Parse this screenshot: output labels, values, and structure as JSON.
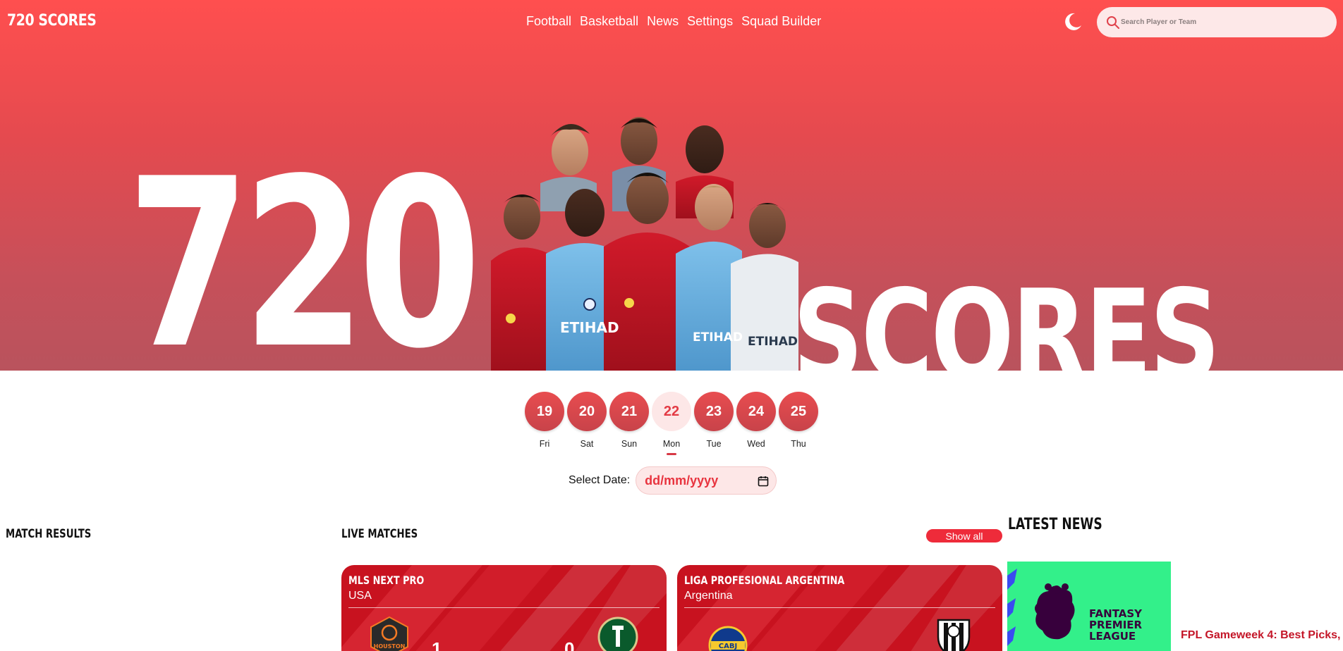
{
  "brand": "720 SCORES",
  "nav": {
    "links": [
      "Football",
      "Basketball",
      "News",
      "Settings",
      "Squad Builder"
    ]
  },
  "search": {
    "placeholder": "Search Player or Team"
  },
  "hero": {
    "big_number": "720",
    "big_word": "SCORES"
  },
  "days": [
    {
      "date": "19",
      "weekday": "Fri",
      "active": false
    },
    {
      "date": "20",
      "weekday": "Sat",
      "active": false
    },
    {
      "date": "21",
      "weekday": "Sun",
      "active": false
    },
    {
      "date": "22",
      "weekday": "Mon",
      "active": true
    },
    {
      "date": "23",
      "weekday": "Tue",
      "active": false
    },
    {
      "date": "24",
      "weekday": "Wed",
      "active": false
    },
    {
      "date": "25",
      "weekday": "Thu",
      "active": false
    }
  ],
  "date_picker": {
    "label": "Select Date:",
    "placeholder": "dd/mm/yyyy"
  },
  "sections": {
    "match_results": "MATCH RESULTS",
    "live_matches": "LIVE MATCHES",
    "latest_news": "LATEST NEWS",
    "show_all": "Show all"
  },
  "live_matches": [
    {
      "league": "MLS NEXT PRO",
      "country": "USA",
      "home_score": "1",
      "away_score": "0",
      "home_logo_text": "HOUSTON"
    },
    {
      "league": "LIGA PROFESIONAL ARGENTINA",
      "country": "Argentina",
      "home_logo_text": "CABJ"
    }
  ],
  "news": {
    "image_text": [
      "FANTASY",
      "PREMIER",
      "LEAGUE"
    ],
    "headline": "FPL Gameweek 4: Best Picks,"
  },
  "colors": {
    "hero_top": "#ff4f4f",
    "hero_bottom": "#b9535d",
    "accent_red": "#ee2b3a",
    "card_red": "#c8121f",
    "news_green": "#33f08a"
  }
}
